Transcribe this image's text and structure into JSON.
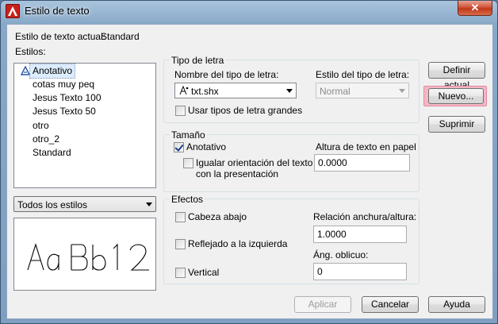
{
  "window": {
    "title": "Estilo de texto",
    "close_glyph": "✕"
  },
  "current_style": {
    "label": "Estilo de texto actual:",
    "value": "Standard"
  },
  "styles": {
    "label": "Estilos:",
    "items": [
      {
        "label": "Anotativo",
        "icon": "annotative-icon",
        "selected": true
      },
      {
        "label": "cotas muy peq"
      },
      {
        "label": "Jesus Texto 100"
      },
      {
        "label": "Jesus Texto 50"
      },
      {
        "label": "otro"
      },
      {
        "label": "otro_2"
      },
      {
        "label": "Standard"
      }
    ]
  },
  "filter": {
    "value": "Todos los estilos"
  },
  "preview": {
    "text": "AaBb12"
  },
  "font_group": {
    "title": "Tipo de letra",
    "font_name_label": "Nombre del tipo de letra:",
    "font_name_value": "txt.shx",
    "font_style_label": "Estilo del tipo de letra:",
    "font_style_value": "Normal",
    "big_font_label": "Usar tipos de letra grandes"
  },
  "size_group": {
    "title": "Tamaño",
    "annotative_label": "Anotativo",
    "annotative_checked": true,
    "match_orientation_label_1": "Igualar orientación del texto",
    "match_orientation_label_2": "con la presentación",
    "height_label": "Altura de texto en papel",
    "height_value": "0.0000"
  },
  "effects_group": {
    "title": "Efectos",
    "upside_down_label": "Cabeza abajo",
    "backwards_label": "Reflejado a la izquierda",
    "vertical_label": "Vertical",
    "width_factor_label": "Relación anchura/altura:",
    "width_factor_value": "1.0000",
    "oblique_label": "Áng. oblicuo:",
    "oblique_value": "0"
  },
  "buttons": {
    "set_current": "Definir actual",
    "new": "Nuevo...",
    "delete": "Suprimir",
    "apply": "Aplicar",
    "cancel": "Cancelar",
    "help": "Ayuda"
  }
}
